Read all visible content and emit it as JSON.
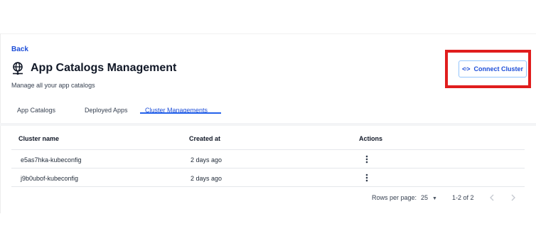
{
  "nav": {
    "back_label": "Back"
  },
  "header": {
    "icon": "globe-network-icon",
    "title": "App Catalogs Management",
    "subtitle": "Manage all your app catalogs"
  },
  "actions": {
    "connect_label": "Connect Cluster",
    "connect_icon": "code-brackets-icon",
    "highlight_color": "#e01d1d"
  },
  "tabs": [
    {
      "label": "App Catalogs",
      "active": false
    },
    {
      "label": "Deployed Apps",
      "active": false
    },
    {
      "label": "Cluster Managements",
      "active": true
    }
  ],
  "table": {
    "columns": [
      "Cluster name",
      "Created at",
      "Actions"
    ],
    "rows": [
      {
        "name": "e5as7hka-kubeconfig",
        "created": "2 days ago"
      },
      {
        "name": "j9b0ubof-kubeconfig",
        "created": "2 days ago"
      }
    ]
  },
  "pagination": {
    "rows_per_page_label": "Rows per page:",
    "rows_per_page_value": "25",
    "range_text": "1-2 of 2"
  },
  "colors": {
    "accent": "#1d4ed8",
    "tab_underline": "#2563eb"
  }
}
